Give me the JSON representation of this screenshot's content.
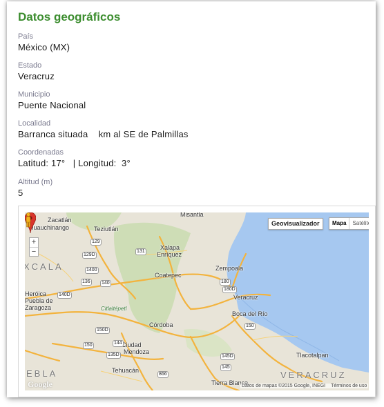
{
  "section": {
    "title": "Datos geográficos"
  },
  "fields": {
    "pais": {
      "label": "País",
      "value": "México (MX)"
    },
    "estado": {
      "label": "Estado",
      "value": "Veracruz"
    },
    "municipio": {
      "label": "Municipio",
      "value": "Puente Nacional"
    },
    "localidad": {
      "label": "Localidad",
      "value": "Barranca situada    km al SE de Palmillas"
    },
    "coordenadas": {
      "label": "Coordenadas",
      "value": "Latitud: 17°   | Longitud:  3°"
    },
    "altitud": {
      "label": "Altitud (m)",
      "value": "5"
    }
  },
  "map": {
    "geo_button": "Geovisualizador",
    "type_map": "Mapa",
    "type_satellite": "Satélite",
    "zoom_in": "+",
    "zoom_out": "−",
    "attribution": "Datos de mapas ©2015 Google, INEGI",
    "terms": "Términos de uso",
    "logo": "Google",
    "places": {
      "zacatlan": "Zacatlán",
      "huauchinango": "Huauchinango",
      "teziutlan": "Teziutlán",
      "misantla": "Misantla",
      "xalapa": "Xalapa",
      "enriquez": "Enríquez",
      "coatepec": "Coatepec",
      "zempoala": "Zempoala",
      "veracruz_city": "Veracruz",
      "boca_del_rio": "Boca del Río",
      "xcala": "XCALA",
      "heroica": "Heróica",
      "puebla_de": "Puebla de",
      "zaragoza": "Zaragoza",
      "citlaltepetl": "Citlaltépetl",
      "cordoba": "Córdoba",
      "ciudad": "Ciudad",
      "mendoza": "Mendoza",
      "tlacotalpan": "Tlacotalpan",
      "tehuacan": "Tehuacán",
      "ebla": "EBLA",
      "tierra_blanca": "Tierra Blanca",
      "veracruz_state": "VERACRUZ"
    },
    "highways": [
      "129",
      "129D",
      "131",
      "1400",
      "140",
      "136",
      "140D",
      "150D",
      "150",
      "144",
      "135D",
      "866",
      "145",
      "145D",
      "180",
      "180D",
      "150"
    ],
    "colors": {
      "water": "#a6c8f0",
      "land": "#e8e4d8",
      "forest": "#c9dcb0",
      "highway": "#f3b33d",
      "pin": "#d9352b"
    }
  }
}
